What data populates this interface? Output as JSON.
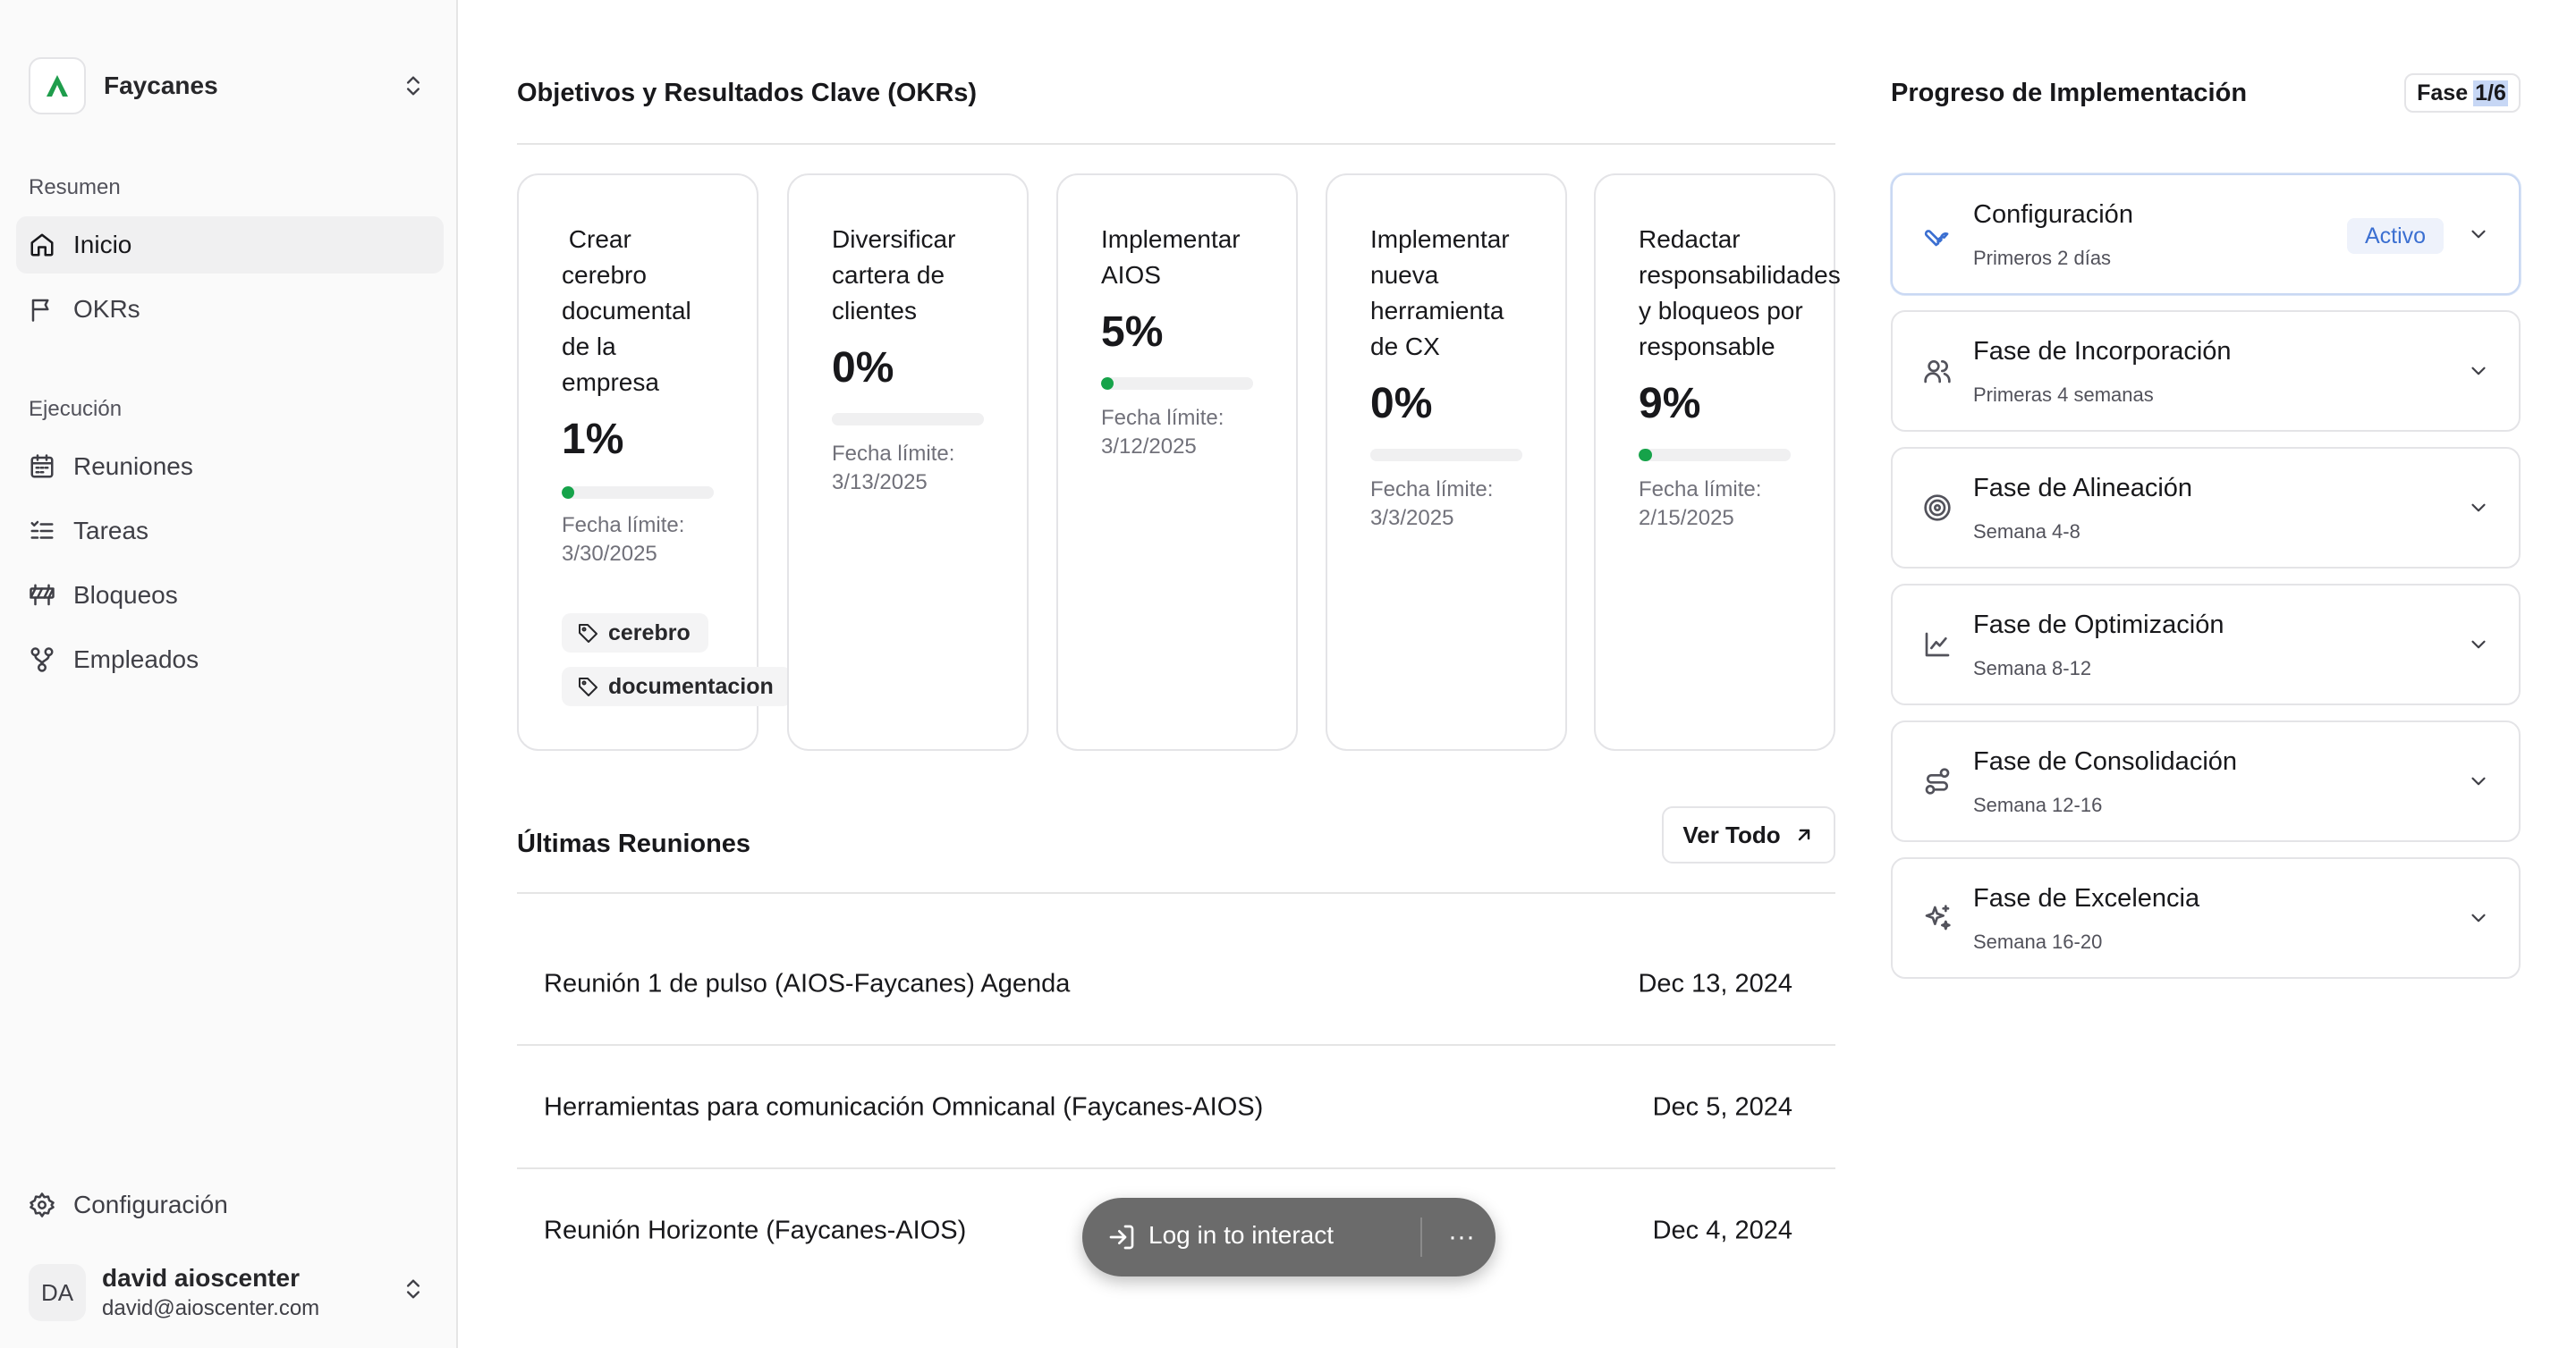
{
  "sidebar": {
    "org_name": "Faycanes",
    "section_resumen": "Resumen",
    "section_ejecucion": "Ejecución",
    "nav": {
      "inicio": "Inicio",
      "okrs": "OKRs",
      "reuniones": "Reuniones",
      "tareas": "Tareas",
      "bloqueos": "Bloqueos",
      "empleados": "Empleados",
      "configuracion": "Configuración"
    },
    "user": {
      "initials": "DA",
      "name": "david aioscenter",
      "email": "david@aioscenter.com"
    }
  },
  "okrs": {
    "title": "Objetivos y Resultados Clave (OKRs)",
    "cards": [
      {
        "title": " Crear\ncerebro\ndocumental\nde la\nempresa",
        "percent": "1%",
        "progress": 0.01,
        "deadline": "Fecha límite:\n3/30/2025",
        "tags": [
          "cerebro",
          "documentacion"
        ]
      },
      {
        "title": "Diversificar\ncartera de\nclientes",
        "percent": "0%",
        "progress": 0,
        "deadline": "Fecha límite:\n3/13/2025",
        "tags": []
      },
      {
        "title": "Implementar\nAIOS",
        "percent": "5%",
        "progress": 0.05,
        "deadline": "Fecha límite:\n3/12/2025",
        "tags": []
      },
      {
        "title": "Implementar\nnueva\nherramienta\nde CX",
        "percent": "0%",
        "progress": 0,
        "deadline": "Fecha límite:\n3/3/2025",
        "tags": []
      },
      {
        "title": "Redactar\nresponsabilidades\ny bloqueos por\nresponsable",
        "percent": "9%",
        "progress": 0.09,
        "deadline": "Fecha límite:\n2/15/2025",
        "tags": []
      }
    ]
  },
  "meetings": {
    "title": "Últimas Reuniones",
    "view_all": "Ver Todo",
    "rows": [
      {
        "title": "Reunión 1 de pulso (AIOS-Faycanes) Agenda",
        "date": "Dec 13, 2024"
      },
      {
        "title": "Herramientas para comunicación Omnicanal (Faycanes-AIOS)",
        "date": "Dec 5, 2024"
      },
      {
        "title": "Reunión Horizonte (Faycanes-AIOS)",
        "date": "Dec 4, 2024"
      }
    ]
  },
  "progress": {
    "title": "Progreso de Implementación",
    "badge_prefix": "Fase",
    "badge_value": "1/6",
    "phases": [
      {
        "title": "Configuración",
        "subtitle": "Primeros 2 días",
        "badge": "Activo",
        "icon": "wrench-icon"
      },
      {
        "title": "Fase de Incorporación",
        "subtitle": "Primeras 4 semanas",
        "icon": "users-icon"
      },
      {
        "title": "Fase de Alineación",
        "subtitle": "Semana 4-8",
        "icon": "target-icon"
      },
      {
        "title": "Fase de Optimización",
        "subtitle": "Semana 8-12",
        "icon": "line-chart-icon"
      },
      {
        "title": "Fase de Consolidación",
        "subtitle": "Semana 12-16",
        "icon": "route-icon"
      },
      {
        "title": "Fase de Excelencia",
        "subtitle": "Semana 16-20",
        "icon": "sparkles-icon"
      }
    ]
  },
  "overlay": {
    "label": "Log in to interact",
    "more": "···"
  },
  "colors": {
    "accent_green": "#16a34a",
    "active_blue": "#3b6fd1"
  }
}
